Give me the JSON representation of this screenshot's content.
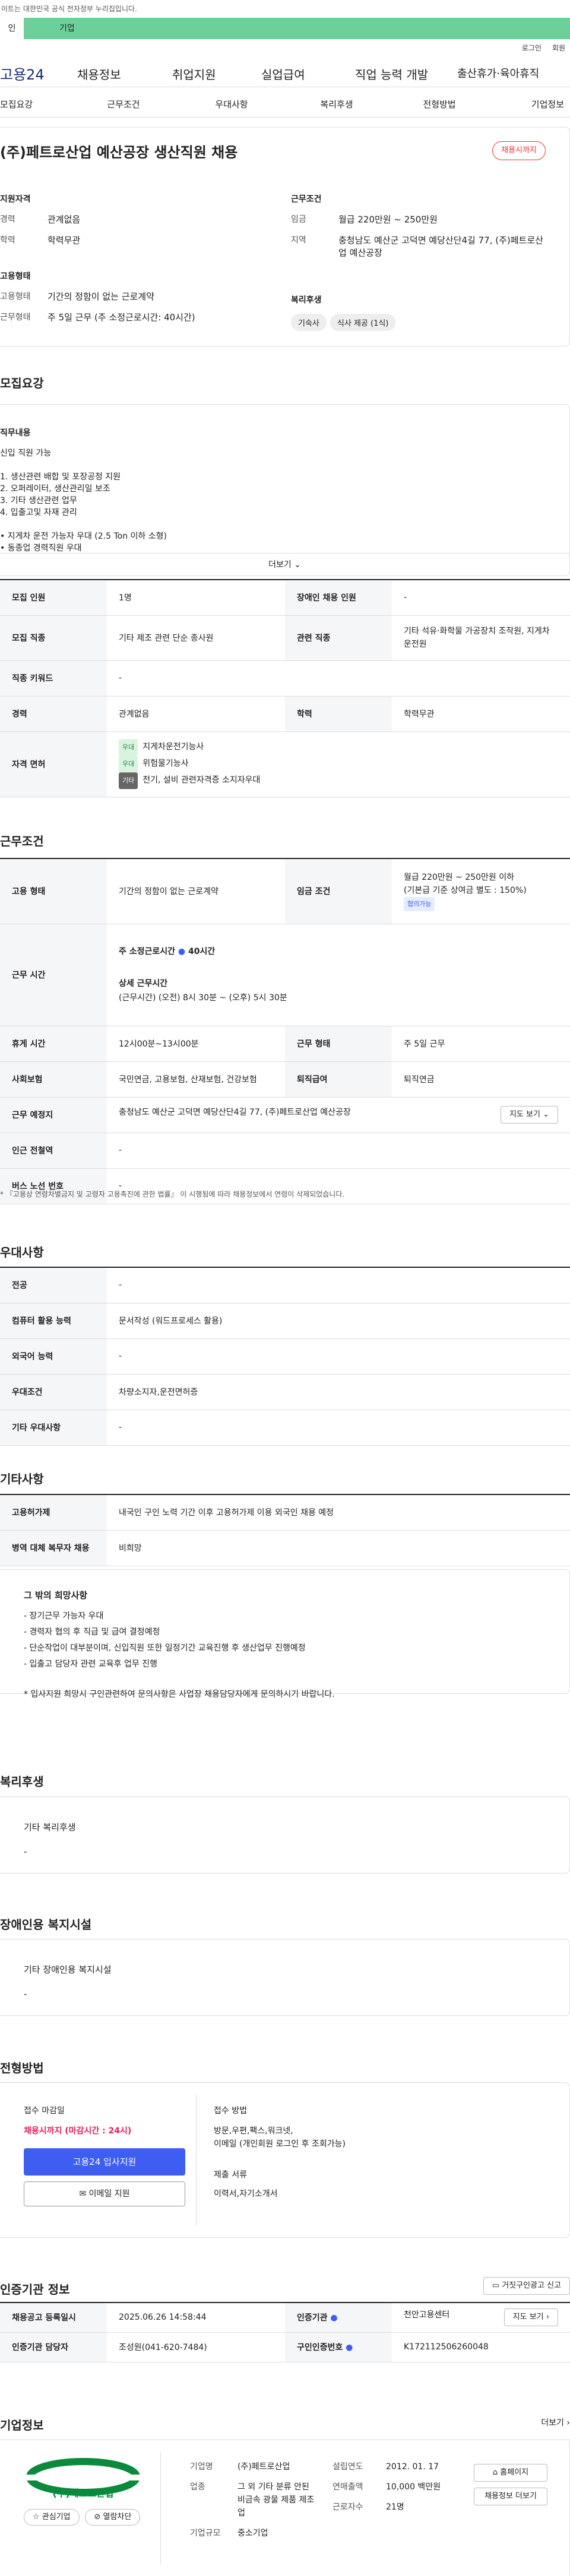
{
  "gov_notice": "이트는 대한민국 공식 전자정부 누리집입니다.",
  "top_tabs": [
    "인",
    "기업"
  ],
  "util": [
    "로그인",
    "회원"
  ],
  "logo": "고용24",
  "gnb": [
    "채용정보",
    "취업지원",
    "실업급여",
    "직업 능력 개발",
    "출산휴가·육아휴직"
  ],
  "tabs": [
    "모집요강",
    "근무조건",
    "우대사항",
    "복리후생",
    "전형방법",
    "기업정보"
  ],
  "job": {
    "title": "(주)페트로산업 예산공장 생산직원 채용",
    "badge": "채용시까지",
    "qual_h": "지원자격",
    "qual": [
      {
        "k": "경력",
        "v": "관계없음"
      },
      {
        "k": "학력",
        "v": "학력무관"
      }
    ],
    "emp_h": "고용형태",
    "emp": [
      {
        "k": "고용형태",
        "v": "기간의 정함이 없는 근로계약"
      },
      {
        "k": "근무형태",
        "v": "주 5일 근무 (주 소정근로시간: 40시간)"
      }
    ],
    "cond_h": "근무조건",
    "cond": [
      {
        "k": "임금",
        "v": "월급 220만원 ~ 250만원"
      },
      {
        "k": "지역",
        "v": "충청남도 예산군 고덕면 예당산단4길 77, (주)페트로산업 예산공장"
      }
    ],
    "welfare_h": "복리후생",
    "welfare_tags": [
      "기숙사",
      "식사 제공 (1식)"
    ]
  },
  "recruit": {
    "h": "모집요강",
    "duty_h": "직무내용",
    "duty": [
      "신입 직원 가능",
      "",
      "1. 생산관련 배합 및 포장공정 지원",
      "2. 오퍼레이터, 생산관리일 보조",
      "3. 기타 생산관련 업무",
      "4. 입출고및 자재 관리",
      "",
      "• 지게차 운전 가능자 우대 (2.5 Ton 이하  소형)",
      "• 동종업 경력직원 우대"
    ],
    "more": "더보기"
  },
  "rtable": {
    "count_k": "모집 인원",
    "count_v": "1명",
    "disab_k": "장애인 채용 인원",
    "disab_v": "-",
    "occ_k": "모집 직종",
    "occ_v": "기타 제조 관련 단순 종사원",
    "rel_k": "관련 직종",
    "rel_v": "기타 석유·화학물 가공장치 조작원, 지게차 운전원",
    "kw_k": "직종 키워드",
    "kw_v": "-",
    "exp_k": "경력",
    "exp_v": "관계없음",
    "edu_k": "학력",
    "edu_v": "학력무관",
    "lic_k": "자격 면허",
    "lic": [
      {
        "tag": "우대",
        "v": "지게차운전기능사"
      },
      {
        "tag": "우대",
        "v": "위험물기능사"
      },
      {
        "tag": "기타",
        "v": "전기, 설비 관련자격증 소지자우대"
      }
    ]
  },
  "work": {
    "h": "근무조건",
    "emp_k": "고용 형태",
    "emp_v": "기간의 정함이 없는 근로계약",
    "wage_k": "임금 조건",
    "wage_v": "월급 220만원 ~ 250만원 이하",
    "wage_sub": "(기본급 기준 상여금 별도 : 150%)",
    "wage_tag": "협의가능",
    "time_k": "근무 시간",
    "time_main": "주 소정근로시간 ",
    "time_hours": "40시간",
    "time_detail_h": "상세 근무시간",
    "time_detail": "(근무시간) (오전) 8시 30분 ~ (오후) 5시 30분",
    "rest_k": "휴게 시간",
    "rest_v": "12시00분~13시00분",
    "form_k": "근무 형태",
    "form_v": "주 5일 근무",
    "ins_k": "사회보험",
    "ins_v": "국민연금, 고용보험, 산재보험, 건강보험",
    "ret_k": "퇴직급여",
    "ret_v": "퇴직연금",
    "place_k": "근무 예정지",
    "place_v": "충청남도 예산군 고덕면 예당산단4길 77, (주)페트로산업 예산공장",
    "map_btn": "지도 보기",
    "sub_k": "인근 전철역",
    "sub_v": "-",
    "bus_k": "버스 노선 번호",
    "bus_v": "-",
    "note": "* 『고용상 연령차별금지 및 고령자 고용촉진에 관한 법률』 이 시행됨에 따라 채용정보에서 연령이 삭제되었습니다."
  },
  "pref": {
    "h": "우대사항",
    "rows": [
      {
        "k": "전공",
        "v": "-"
      },
      {
        "k": "컴퓨터 활용 능력",
        "v": "문서작성 (워드프로세스 활용)"
      },
      {
        "k": "외국어 능력",
        "v": "-"
      },
      {
        "k": "우대조건",
        "v": "차량소지자,운전면허증"
      },
      {
        "k": "기타 우대사항",
        "v": "-"
      }
    ]
  },
  "etc": {
    "h": "기타사항",
    "rows": [
      {
        "k": "고용허가제",
        "v": "내국인 구인 노력 기간 이후 고용허가제 이용 외국인 채용 예정"
      },
      {
        "k": "병역 대체 복무자 채용",
        "v": "비희망"
      }
    ],
    "card_h": "그 밖의 희망사항",
    "card": [
      "- 장기근무 가능자 우대",
      "- 경력자 협의 후 직급 및 급여 결정예정",
      "- 단순작업이 대부분이며, 신입직원 또한 일정기간 교육진행 후 생산업무 진행예정",
      "- 입출고 담당자 관련 교육후 업무 진행",
      "",
      "* 입사지원 희망시 구인관련하여 문의사항은 사업장 채용담당자에게 문의하시기 바랍니다."
    ]
  },
  "benefit": {
    "h": "복리후생",
    "card_h": "기타 복리후생",
    "card_v": "-"
  },
  "disab": {
    "h": "장애인용 복지시설",
    "card_h": "기타 장애인용 복지시설",
    "card_v": "-"
  },
  "process": {
    "h": "전형방법",
    "deadline_h": "접수 마감일",
    "deadline_v": "채용시까지 (마감시간 : 24시)",
    "apply_btn": "고용24 입사지원",
    "email_btn": "이메일 지원",
    "method_h": "접수 방법",
    "method_v": "방문,우편,팩스,워크넷,",
    "method_v2": "이메일 (개인회원 로그인 후 조회가능)",
    "docs_h": "제출 서류",
    "docs_v": "이력서,자기소개서"
  },
  "agency": {
    "h": "인증기관 정보",
    "report_btn": "거짓구인광고 신고",
    "reg_k": "채용공고 등록일시",
    "reg_v": "2025.06.26 14:58:44",
    "org_k": "인증기관",
    "org_v": "천안고용센터",
    "map_btn": "지도 보기",
    "mgr_k": "인증기관 담당자",
    "mgr_v": "조성원(041-620-7484)",
    "no_k": "구인인증번호",
    "no_v": "K172112506260048"
  },
  "company": {
    "h": "기업정보",
    "more": "더보기",
    "logo_text": "(주)페트로산업",
    "fav_btn": "관심기업",
    "block_btn": "열람차단",
    "name_k": "기업명",
    "name_v": "(주)페트로산업",
    "ind_k": "업종",
    "ind_v": "그 외 기타 분류 안된 비금속 광물 제품 제조업",
    "size_k": "기업규모",
    "size_v": "중소기업",
    "est_k": "설립연도",
    "est_v": "2012. 01. 17",
    "sales_k": "연매출액",
    "sales_v": "10,000 백만원",
    "emp_k": "근로자수",
    "emp_v": "21명",
    "home_btn": "홈페이지",
    "jobs_btn": "채용정보 더보기"
  }
}
